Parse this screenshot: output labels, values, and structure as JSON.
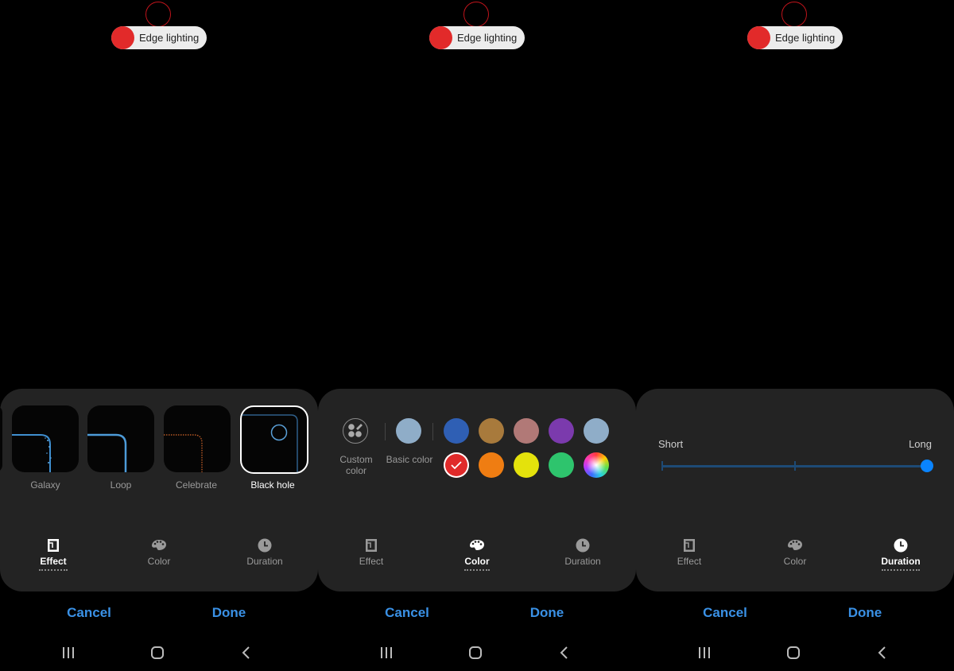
{
  "screens": [
    {
      "preview": {
        "toggle_label": "Edge lighting",
        "toggle_color": "#e22a2a"
      },
      "effects": [
        {
          "label": "Galaxy",
          "selected": false
        },
        {
          "label": "Loop",
          "selected": false
        },
        {
          "label": "Celebrate",
          "selected": false
        },
        {
          "label": "Black hole",
          "selected": true
        }
      ],
      "tabs": [
        {
          "label": "Effect",
          "icon": "effect-icon",
          "active": true
        },
        {
          "label": "Color",
          "icon": "palette-icon",
          "active": false
        },
        {
          "label": "Duration",
          "icon": "clock-icon",
          "active": false
        }
      ],
      "actions": {
        "cancel": "Cancel",
        "done": "Done"
      }
    },
    {
      "preview": {
        "toggle_label": "Edge lighting",
        "toggle_color": "#e22a2a"
      },
      "color": {
        "custom_label": "Custom color",
        "custom_label_line1": "Custom",
        "custom_label_line2": "color",
        "basic_label": "Basic color",
        "basic_swatch": "#8fadc8",
        "swatches_row1": [
          "#2f5fb4",
          "#a87a3c",
          "#b17977",
          "#7b3aad",
          "#8fadc8"
        ],
        "swatches_row2": [
          "#e02a2a",
          "#ef7d12",
          "#e4e20c",
          "#2ec46d",
          "rainbow"
        ],
        "selected": "#e02a2a"
      },
      "tabs": [
        {
          "label": "Effect",
          "icon": "effect-icon",
          "active": false
        },
        {
          "label": "Color",
          "icon": "palette-icon",
          "active": true
        },
        {
          "label": "Duration",
          "icon": "clock-icon",
          "active": false
        }
      ],
      "actions": {
        "cancel": "Cancel",
        "done": "Done"
      }
    },
    {
      "preview": {
        "toggle_label": "Edge lighting",
        "toggle_color": "#e22a2a"
      },
      "duration": {
        "min_label": "Short",
        "max_label": "Long",
        "value": 1.0,
        "steps": 3
      },
      "tabs": [
        {
          "label": "Effect",
          "icon": "effect-icon",
          "active": false
        },
        {
          "label": "Color",
          "icon": "palette-icon",
          "active": false
        },
        {
          "label": "Duration",
          "icon": "clock-icon",
          "active": true
        }
      ],
      "actions": {
        "cancel": "Cancel",
        "done": "Done"
      }
    }
  ],
  "accent_color": "#3a91e6",
  "slider_color": "#0a84ff"
}
